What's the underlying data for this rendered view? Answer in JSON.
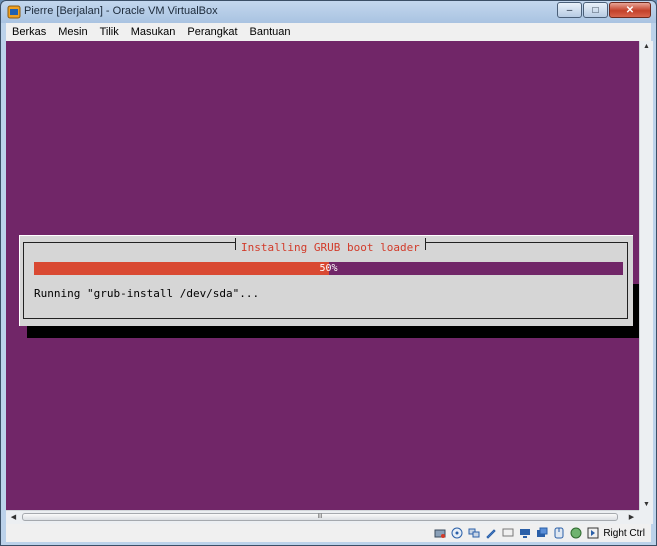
{
  "window": {
    "title": "Pierre [Berjalan] - Oracle VM VirtualBox",
    "minimize_glyph": "–",
    "maximize_glyph": "□",
    "close_glyph": "✕"
  },
  "menubar": {
    "items": [
      "Berkas",
      "Mesin",
      "Tilik",
      "Masukan",
      "Perangkat",
      "Bantuan"
    ]
  },
  "guest": {
    "background_color": "#712668",
    "dialog": {
      "title": "Installing GRUB boot loader",
      "progress_percent": 50,
      "progress_label": "50%",
      "status_text": "Running \"grub-install /dev/sda\"...",
      "accent_color": "#d94932"
    }
  },
  "scrollbars": {
    "up_glyph": "▲",
    "down_glyph": "▼",
    "left_glyph": "◀",
    "right_glyph": "▶",
    "thumb_grip": "III"
  },
  "statusbar": {
    "icons": [
      "harddisk-icon",
      "optical-drive-icon",
      "usb-icon",
      "shared-folders-icon",
      "display-icon",
      "network-icon",
      "video-capture-icon",
      "mouse-integration-icon",
      "host-key-icon"
    ],
    "host_key": "Right Ctrl"
  }
}
